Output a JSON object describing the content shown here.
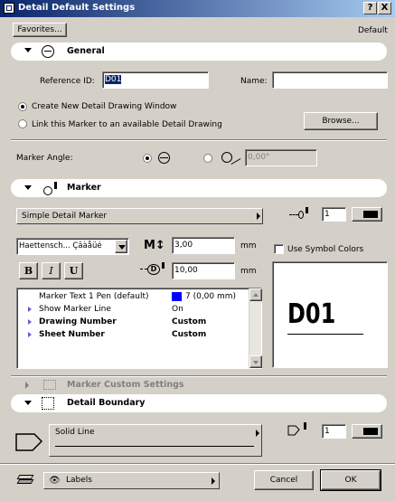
{
  "window": {
    "title": "Detail Default Settings",
    "help_glyph": "?",
    "close_glyph": "X"
  },
  "toolbar": {
    "favorites_label": "Favorites...",
    "default_label": "Default"
  },
  "general": {
    "header": "General",
    "reference_id_label": "Reference ID:",
    "reference_id_value": "D01",
    "name_label": "Name:",
    "name_value": "",
    "option_create": "Create New Detail Drawing Window",
    "option_link": "Link this Marker to an available Detail Drawing",
    "browse_label": "Browse...",
    "marker_angle_label": "Marker Angle:",
    "angle_value": "0,00°"
  },
  "marker": {
    "header": "Marker",
    "type_value": "Simple Detail Marker",
    "pen_value": "1",
    "font_value": "Haettensch... Çäàåüé",
    "text_size_value": "3,00",
    "text_size_unit": "mm",
    "offset_value": "10,00",
    "offset_unit": "mm",
    "use_symbol_colors": "Use Symbol Colors",
    "bold_label": "B",
    "italic_label": "I",
    "underline_label": "U",
    "params": [
      {
        "name": "Marker Text 1 Pen (default)",
        "value": "7 (0,00 mm)",
        "bold": false,
        "tri": false,
        "swatch": "#0000ff"
      },
      {
        "name": "Show Marker Line",
        "value": "On",
        "bold": false,
        "tri": true
      },
      {
        "name": "Drawing Number",
        "value": "Custom",
        "bold": true,
        "tri": true
      },
      {
        "name": "Sheet Number",
        "value": "Custom",
        "bold": true,
        "tri": true
      }
    ],
    "preview_text": "D01"
  },
  "custom": {
    "header": "Marker Custom Settings"
  },
  "boundary": {
    "header": "Detail Boundary",
    "line_type": "Solid Line",
    "pen_value": "1"
  },
  "footer": {
    "layer_value": "Labels",
    "cancel_label": "Cancel",
    "ok_label": "OK"
  },
  "colors": {
    "titlebar": "#0a246a",
    "face": "#d4d0c8",
    "param_swatch": "#0000ff"
  }
}
